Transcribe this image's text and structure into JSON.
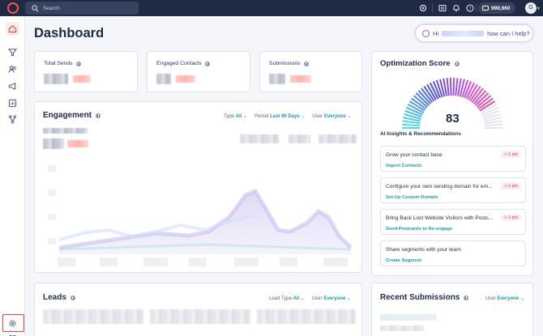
{
  "topbar": {
    "search_placeholder": "Search",
    "credits": "999,960",
    "avatar_initial": "G"
  },
  "page": {
    "title": "Dashboard"
  },
  "ai_assistant": {
    "greeting": "Hi",
    "question": "how can I help?"
  },
  "stats": [
    {
      "label": "Total Sends"
    },
    {
      "label": "Engaged Contacts"
    },
    {
      "label": "Submissions"
    }
  ],
  "engagement": {
    "title": "Engagement",
    "filters": {
      "type_label": "Type",
      "type_value": "All",
      "period_label": "Period",
      "period_value": "Last 90 Days",
      "user_label": "User",
      "user_value": "Everyone"
    }
  },
  "optimization": {
    "title": "Optimization Score",
    "score": "83",
    "score_value": 83,
    "insights_heading": "AI Insights & Recommendations",
    "recommendations": [
      {
        "title": "Grow your contact base",
        "action": "Import Contacts",
        "points": "+ 1 pts"
      },
      {
        "title": "Configure your own sending domain for em...",
        "action": "Set Up Custom Domain",
        "points": "+ 1 pts"
      },
      {
        "title": "Bring Back Lost Website Visitors with Postc...",
        "action": "Send Postcards to Re-engage",
        "points": "+ 1 pts"
      },
      {
        "title": "Share segments with your team",
        "action": "Create Segment",
        "points": ""
      }
    ]
  },
  "leads": {
    "title": "Leads",
    "filters": {
      "type_label": "Lead Type",
      "type_value": "All",
      "user_label": "User",
      "user_value": "Everyone"
    }
  },
  "recent_submissions": {
    "title": "Recent Submissions",
    "filters": {
      "user_label": "User",
      "user_value": "Everyone"
    }
  },
  "colors": {
    "topbar": "#1f2a44",
    "accent_teal": "#1f9aa0",
    "brand_red": "#f0564a",
    "highlight_box": "#e8443c"
  },
  "icons": {
    "sidebar": [
      "home-icon",
      "funnel-icon",
      "contacts-icon",
      "megaphone-icon",
      "reports-icon",
      "workflow-icon",
      "settings-icon",
      "apps-icon"
    ],
    "topbar": [
      "sparkle-icon",
      "inbox-icon",
      "bell-icon",
      "help-icon",
      "credits-icon"
    ]
  }
}
